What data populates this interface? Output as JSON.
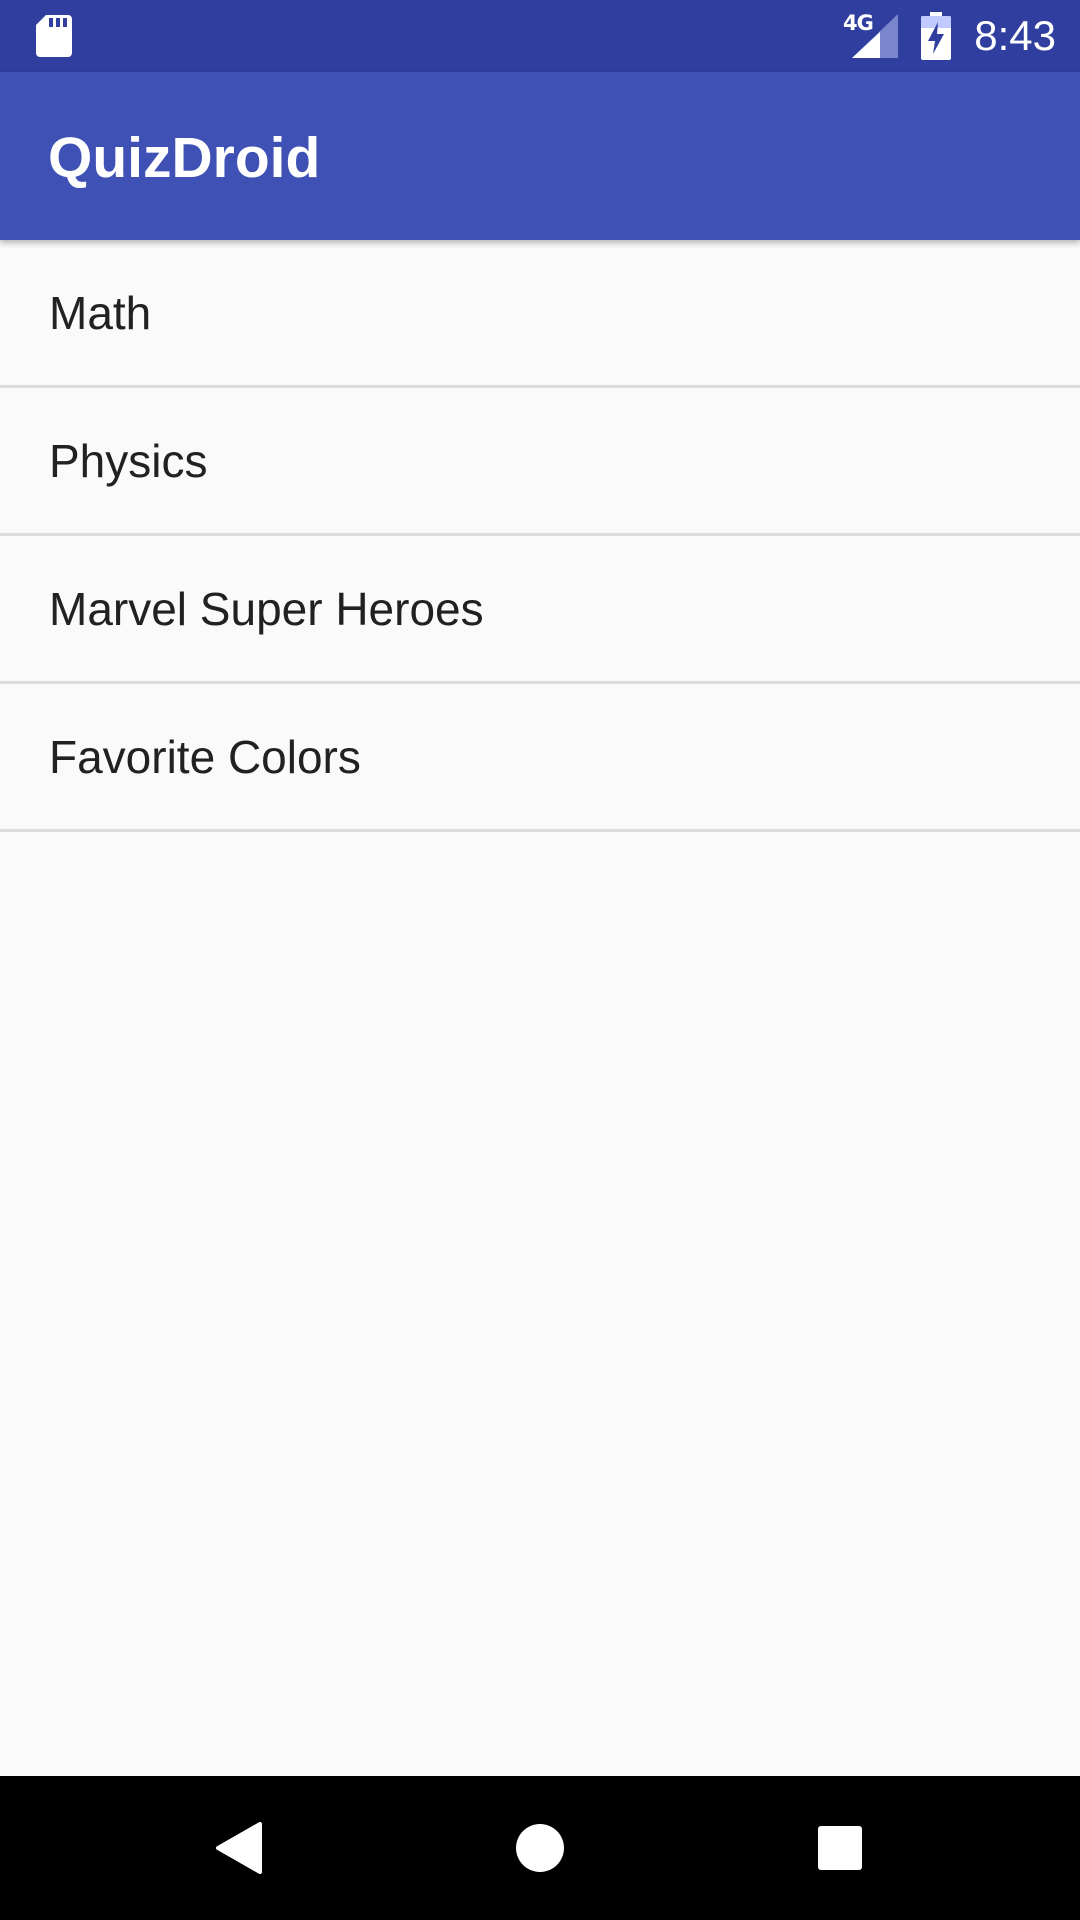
{
  "status_bar": {
    "network_type": "4G",
    "time": "8:43",
    "icons": [
      "sd-card-icon",
      "signal-icon",
      "battery-charging-icon"
    ]
  },
  "app_bar": {
    "title": "QuizDroid"
  },
  "quiz_list": {
    "items": [
      {
        "label": "Math"
      },
      {
        "label": "Physics"
      },
      {
        "label": "Marvel Super Heroes"
      },
      {
        "label": "Favorite Colors"
      }
    ]
  },
  "nav_bar": {
    "icons": [
      "back-icon",
      "home-icon",
      "recents-icon"
    ]
  },
  "colors": {
    "status_bar": "#303f9f",
    "app_bar": "#3f51b5",
    "background": "#fafafa",
    "divider": "#dcdcdc",
    "text_primary": "#212121"
  }
}
